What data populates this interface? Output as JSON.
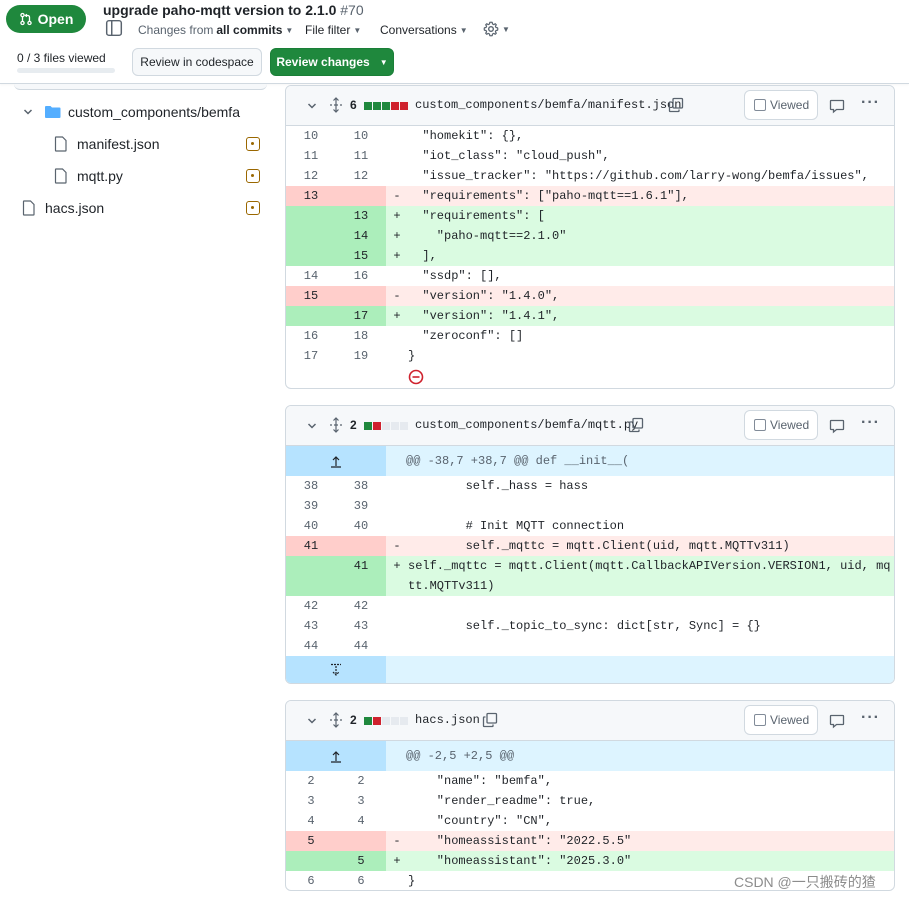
{
  "header": {
    "status": "Open",
    "title": "upgrade paho-mqtt version to 2.1.0",
    "pr_number": "#70",
    "changes_from": "Changes from",
    "all_commits": "all commits",
    "file_filter": "File filter",
    "conversations": "Conversations",
    "files_viewed": "0 / 3 files viewed",
    "review_codespace": "Review in codespace",
    "review_changes": "Review changes"
  },
  "tree": {
    "folder": "custom_components/bemfa",
    "file1": "manifest.json",
    "file2": "mqtt.py",
    "file3": "hacs.json"
  },
  "files": [
    {
      "count": "6",
      "name": "custom_components/bemfa/manifest.json",
      "viewed": "Viewed",
      "lines": [
        {
          "t": "ctx",
          "o": "10",
          "n": "10",
          "c": "  \"homekit\": {},"
        },
        {
          "t": "ctx",
          "o": "11",
          "n": "11",
          "c": "  \"iot_class\": \"cloud_push\","
        },
        {
          "t": "ctx",
          "o": "12",
          "n": "12",
          "c": "  \"issue_tracker\": \"https://github.com/larry-wong/bemfa/issues\","
        },
        {
          "t": "del",
          "o": "13",
          "n": "",
          "c": "  \"requirements\": [\"paho-mqtt==1.6.1\"],"
        },
        {
          "t": "add",
          "o": "",
          "n": "13",
          "c": "  \"requirements\": ["
        },
        {
          "t": "add",
          "o": "",
          "n": "14",
          "c": "    \"paho-mqtt==2.1.0\""
        },
        {
          "t": "add",
          "o": "",
          "n": "15",
          "c": "  ],"
        },
        {
          "t": "ctx",
          "o": "14",
          "n": "16",
          "c": "  \"ssdp\": [],"
        },
        {
          "t": "del",
          "o": "15",
          "n": "",
          "c": "  \"version\": \"1.4.0\","
        },
        {
          "t": "add",
          "o": "",
          "n": "17",
          "c": "  \"version\": \"1.4.1\","
        },
        {
          "t": "ctx",
          "o": "16",
          "n": "18",
          "c": "  \"zeroconf\": []"
        },
        {
          "t": "ctx",
          "o": "17",
          "n": "19",
          "c": "}"
        }
      ]
    },
    {
      "count": "2",
      "name": "custom_components/bemfa/mqtt.py",
      "viewed": "Viewed",
      "hunk": "@@ -38,7 +38,7 @@ def __init__(",
      "lines": [
        {
          "t": "ctx",
          "o": "38",
          "n": "38",
          "c": "        self._hass = hass"
        },
        {
          "t": "ctx",
          "o": "39",
          "n": "39",
          "c": ""
        },
        {
          "t": "ctx",
          "o": "40",
          "n": "40",
          "c": "        # Init MQTT connection"
        },
        {
          "t": "del",
          "o": "41",
          "n": "",
          "c": "        self._mqttc = mqtt.Client(uid, mqtt.MQTTv311)"
        },
        {
          "t": "add",
          "o": "",
          "n": "41",
          "c": "        self._mqttc = mqtt.Client(mqtt.CallbackAPIVersion.VERSION1, uid, mqtt.MQTTv311)"
        },
        {
          "t": "ctx",
          "o": "42",
          "n": "42",
          "c": ""
        },
        {
          "t": "ctx",
          "o": "43",
          "n": "43",
          "c": "        self._topic_to_sync: dict[str, Sync] = {}"
        },
        {
          "t": "ctx",
          "o": "44",
          "n": "44",
          "c": ""
        }
      ]
    },
    {
      "count": "2",
      "name": "hacs.json",
      "viewed": "Viewed",
      "hunk": "@@ -2,5 +2,5 @@",
      "lines": [
        {
          "t": "ctx",
          "o": "2",
          "n": "2",
          "c": "    \"name\": \"bemfa\","
        },
        {
          "t": "ctx",
          "o": "3",
          "n": "3",
          "c": "    \"render_readme\": true,"
        },
        {
          "t": "ctx",
          "o": "4",
          "n": "4",
          "c": "    \"country\": \"CN\","
        },
        {
          "t": "del",
          "o": "5",
          "n": "",
          "c": "    \"homeassistant\": \"2022.5.5\""
        },
        {
          "t": "add",
          "o": "",
          "n": "5",
          "c": "    \"homeassistant\": \"2025.3.0\""
        },
        {
          "t": "ctx",
          "o": "6",
          "n": "6",
          "c": "}"
        }
      ]
    }
  ],
  "watermark": "CSDN @一只搬砖的猹"
}
